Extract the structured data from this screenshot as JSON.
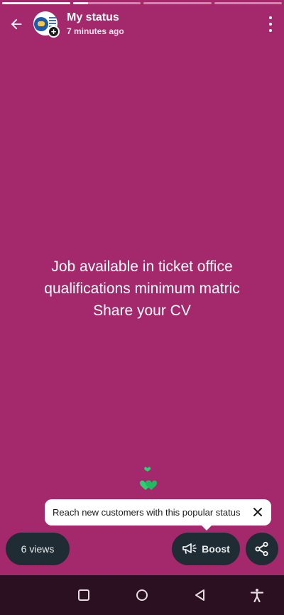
{
  "progress": [
    1.0,
    0.22,
    0.0,
    0.0
  ],
  "header": {
    "title": "My status",
    "time": "7 minutes ago",
    "back_icon": "arrow-left-icon",
    "menu_icon": "more-vertical-icon",
    "add_badge": "+"
  },
  "status": {
    "lines": [
      "Job available in ticket office",
      "qualifications minimum matric",
      "Share your CV"
    ],
    "background_color": "#a3286c"
  },
  "reactions": {
    "icon": "green-hearts-icon",
    "color": "#2bd06f"
  },
  "tooltip": {
    "text": "Reach new customers with this popular status",
    "close_icon": "close-icon"
  },
  "footer": {
    "views_label": "6 views",
    "boost_label": "Boost",
    "boost_icon": "megaphone-icon",
    "share_icon": "share-icon"
  },
  "navbar": {
    "items": [
      "recent-apps-icon",
      "home-icon",
      "back-triangle-icon",
      "accessibility-icon"
    ]
  }
}
